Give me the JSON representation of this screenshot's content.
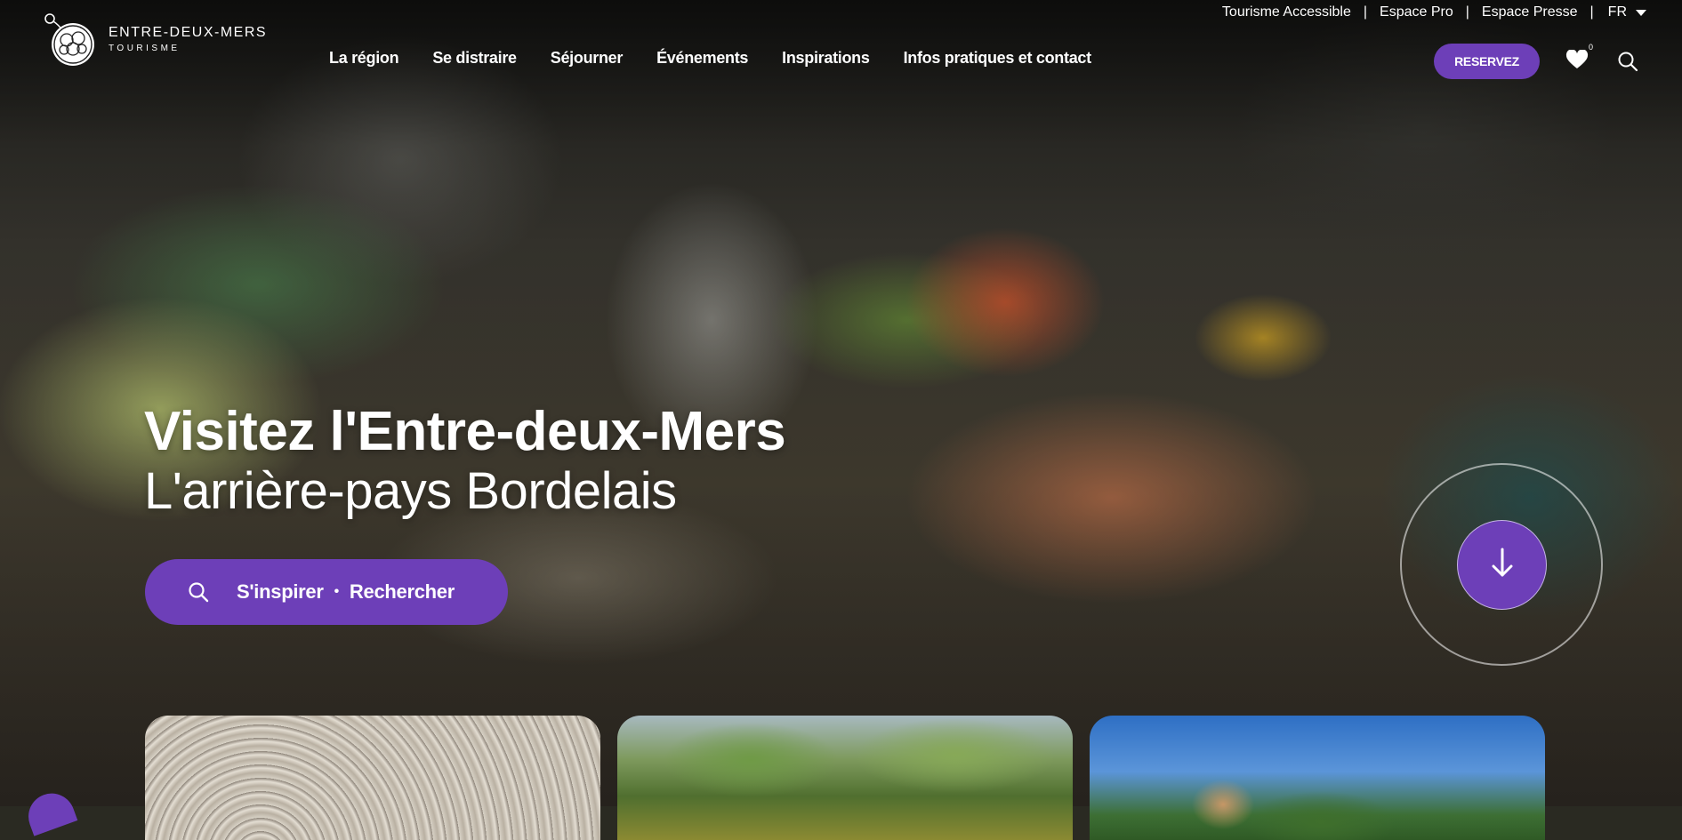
{
  "brand": {
    "name": "ENTRE-DEUX-MERS",
    "tagline": "TOURISME",
    "accent": "#6d3fb8"
  },
  "utility_links": [
    "Tourisme Accessible",
    "Espace Pro",
    "Espace Presse"
  ],
  "language": {
    "selected": "FR"
  },
  "nav": {
    "items": [
      {
        "label": "La région"
      },
      {
        "label": "Se distraire"
      },
      {
        "label": "Séjourner"
      },
      {
        "label": "Événements"
      },
      {
        "label": "Inspirations"
      },
      {
        "label": "Infos pratiques et contact"
      }
    ],
    "reserve_label": "RESERVEZ",
    "favorites_count": "0"
  },
  "hero": {
    "title": "Visitez l'Entre-deux-Mers",
    "subtitle": "L'arrière-pays Bordelais",
    "cta_inspire": "S'inspirer",
    "cta_separator": "•",
    "cta_search": "Rechercher"
  },
  "icons": {
    "logo": "grape-cluster-logo-icon",
    "favorites": "heart-icon",
    "search": "search-icon",
    "scroll": "arrow-down-icon",
    "language_caret": "caret-down-icon"
  }
}
